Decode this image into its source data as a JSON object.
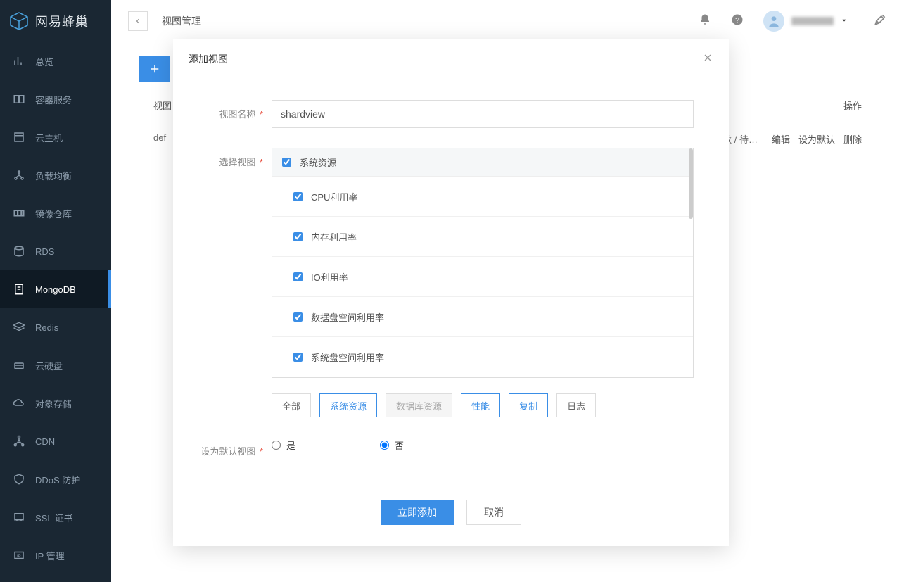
{
  "brand": {
    "name": "网易蜂巢"
  },
  "sidebar": {
    "items": [
      {
        "label": "总览",
        "icon": "overview"
      },
      {
        "label": "容器服务",
        "icon": "container"
      },
      {
        "label": "云主机",
        "icon": "vm"
      },
      {
        "label": "负载均衡",
        "icon": "lb"
      },
      {
        "label": "镜像仓库",
        "icon": "image"
      },
      {
        "label": "RDS",
        "icon": "rds"
      },
      {
        "label": "MongoDB",
        "icon": "mongo"
      },
      {
        "label": "Redis",
        "icon": "redis"
      },
      {
        "label": "云硬盘",
        "icon": "disk"
      },
      {
        "label": "对象存储",
        "icon": "storage"
      },
      {
        "label": "CDN",
        "icon": "cdn"
      },
      {
        "label": "DDoS 防护",
        "icon": "shield"
      },
      {
        "label": "SSL 证书",
        "icon": "ssl"
      },
      {
        "label": "IP 管理",
        "icon": "ip"
      }
    ]
  },
  "topbar": {
    "pageTitle": "视图管理"
  },
  "table": {
    "headers": {
      "name": "视图",
      "ops": "操作"
    },
    "rowNameTruncated": "def",
    "rowConnTruncated": "接数 / 待…",
    "rowOps": {
      "edit": "编辑",
      "setDefault": "设为默认",
      "delete": "删除"
    }
  },
  "modal": {
    "title": "添加视图",
    "labels": {
      "viewName": "视图名称",
      "selectView": "选择视图",
      "setDefault": "设为默认视图"
    },
    "viewNameValue": "shardview",
    "tree": {
      "groupHeader": "系统资源",
      "items": [
        "CPU利用率",
        "内存利用率",
        "IO利用率",
        "数据盘空间利用率",
        "系统盘空间利用率"
      ]
    },
    "filters": {
      "all": "全部",
      "system": "系统资源",
      "database": "数据库资源",
      "perf": "性能",
      "replication": "复制",
      "log": "日志"
    },
    "radio": {
      "yes": "是",
      "no": "否"
    },
    "actions": {
      "submit": "立即添加",
      "cancel": "取消"
    }
  }
}
